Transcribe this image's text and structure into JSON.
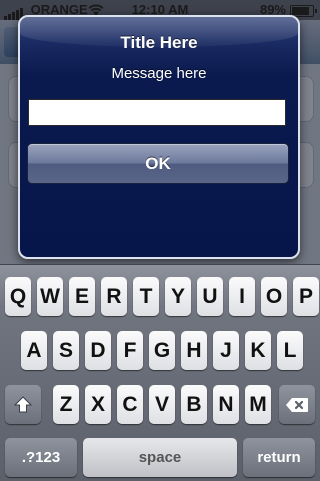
{
  "status_bar": {
    "carrier": "ORANGE",
    "time": "12:10 AM",
    "battery": "89%",
    "battery_level": 0.89,
    "icons": [
      "signal-icon",
      "wifi-icon",
      "battery-icon"
    ]
  },
  "alert": {
    "title": "Title Here",
    "message": "Message here",
    "input_value": "",
    "input_placeholder": "",
    "ok_label": "OK"
  },
  "keyboard": {
    "row1": [
      "Q",
      "W",
      "E",
      "R",
      "T",
      "Y",
      "U",
      "I",
      "O",
      "P"
    ],
    "row2": [
      "A",
      "S",
      "D",
      "F",
      "G",
      "H",
      "J",
      "K",
      "L"
    ],
    "row3": [
      "Z",
      "X",
      "C",
      "V",
      "B",
      "N",
      "M"
    ],
    "shift_icon": "shift-icon",
    "delete_icon": "delete-icon",
    "numbers_label": ".?123",
    "space_label": "space",
    "return_label": "return"
  },
  "colors": {
    "alert_bg": "#06154a",
    "alert_border": "#dde3ee",
    "button_bg": "#6e7a9c",
    "keyboard_bg": "#70757f"
  }
}
